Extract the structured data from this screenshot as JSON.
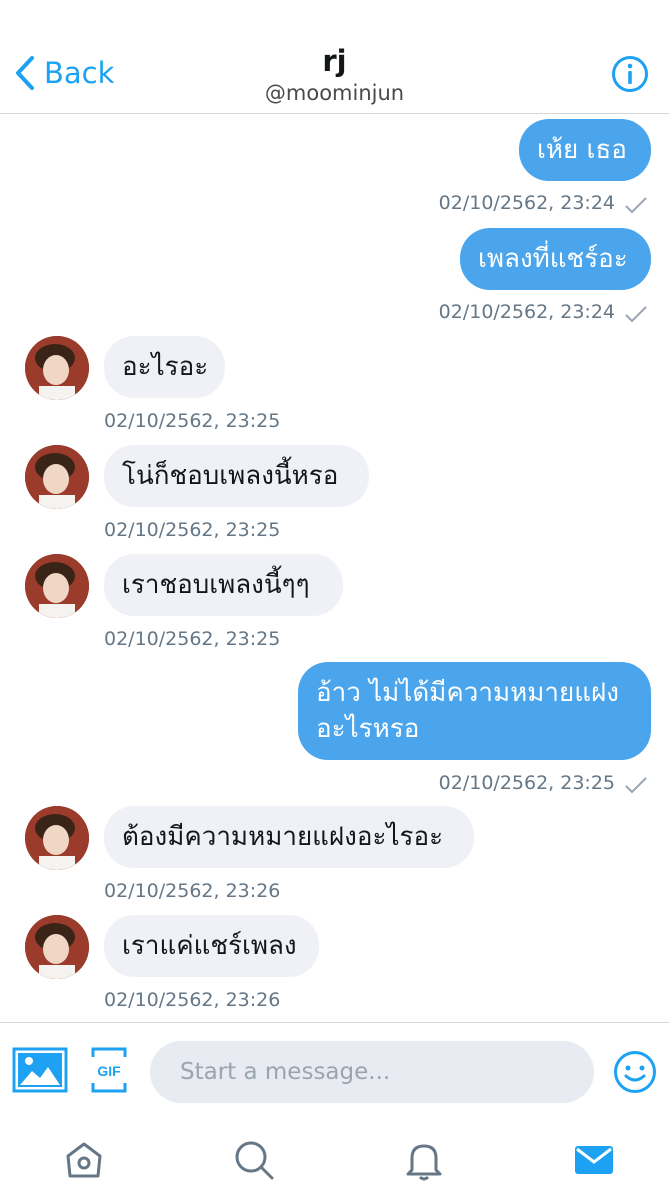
{
  "header": {
    "back_label": "Back",
    "name": "rj",
    "handle": "@moominjun"
  },
  "messages": [
    {
      "side": "out",
      "text": "เห้ย เธอ",
      "timestamp": "02/10/2562, 23:24"
    },
    {
      "side": "out",
      "text": "เพลงที่แชร์อะ",
      "timestamp": "02/10/2562, 23:24"
    },
    {
      "side": "in",
      "text": "อะไรอะ",
      "timestamp": "02/10/2562, 23:25"
    },
    {
      "side": "in",
      "text": "โน่ก็ชอบเพลงนี้หรอ",
      "timestamp": "02/10/2562, 23:25"
    },
    {
      "side": "in",
      "text": "เราชอบเพลงนี้ๆๆ",
      "timestamp": "02/10/2562, 23:25"
    },
    {
      "side": "out",
      "text_line1": "อ้าว ไม่ได้มีความหมายแฝง",
      "text_line2": "อะไรหรอ",
      "timestamp": "02/10/2562, 23:25"
    },
    {
      "side": "in",
      "text": "ต้องมีความหมายแฝงอะไรอะ",
      "timestamp": "02/10/2562, 23:26"
    },
    {
      "side": "in",
      "text": "เราแค่แชร์เพลง",
      "timestamp": "02/10/2562, 23:26"
    }
  ],
  "composer": {
    "placeholder": "Start a message..."
  },
  "colors": {
    "accent": "#1da1f2",
    "outgoing_bubble": "#4aa5ec",
    "incoming_bubble": "#f0f1f6"
  },
  "icons": [
    "chevron-left-icon",
    "info-icon",
    "image-icon",
    "gif-icon",
    "emoji-icon",
    "home-icon",
    "search-icon",
    "bell-icon",
    "mail-icon",
    "checkmark-icon"
  ]
}
